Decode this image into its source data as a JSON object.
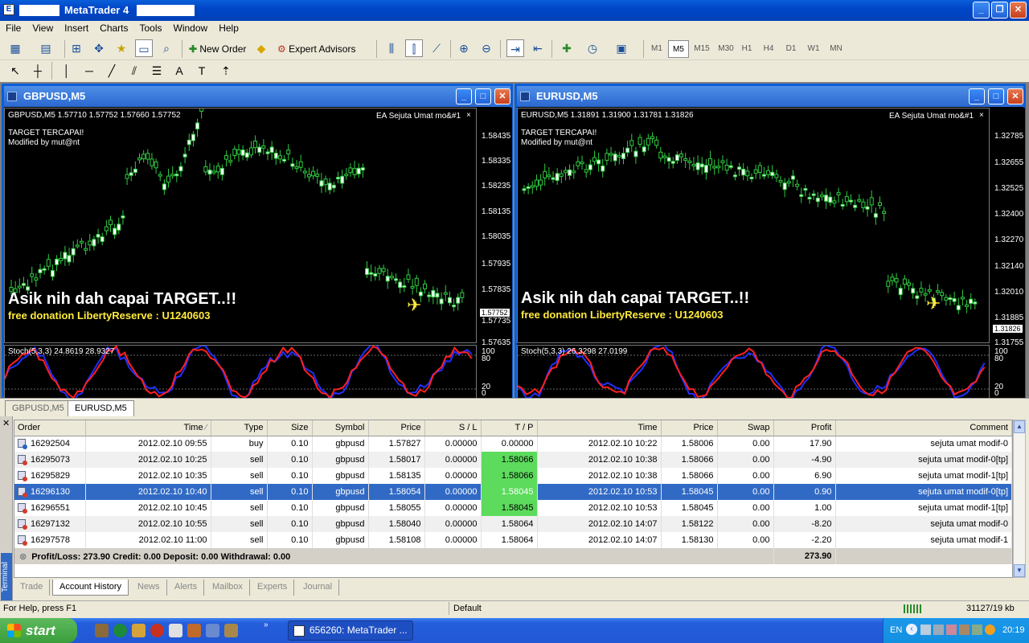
{
  "window": {
    "title": "MetaTrader 4"
  },
  "menu": [
    "File",
    "View",
    "Insert",
    "Charts",
    "Tools",
    "Window",
    "Help"
  ],
  "toolbar": {
    "new_order": "New Order",
    "expert_advisors": "Expert Advisors",
    "timeframes": [
      "M1",
      "M5",
      "M15",
      "M30",
      "H1",
      "H4",
      "D1",
      "W1",
      "MN"
    ],
    "active_timeframe": "M5"
  },
  "charts": {
    "gbp": {
      "title": "GBPUSD,M5",
      "info": "GBPUSD,M5  1.57710 1.57752 1.57660 1.57752",
      "ea": "EA Sejuta Umat mo&#1",
      "target": "TARGET TERCAPAI!",
      "modified": "Modified by mut@nt",
      "banner": "Asik nih dah capai TARGET..!!",
      "donation": "free donation LibertyReserve : U1240603",
      "stoch": "Stoch(5,3,3) 24.8619 28.9327",
      "price_current": "1.57752",
      "ticks": [
        "1.58435",
        "1.58335",
        "1.58235",
        "1.58135",
        "1.58035",
        "1.57935",
        "1.57835",
        "1.57735",
        "1.57635"
      ],
      "stoch_ticks": [
        "100",
        "80",
        "20",
        "0"
      ]
    },
    "eur": {
      "title": "EURUSD,M5",
      "info": "EURUSD,M5  1.31891 1.31900 1.31781 1.31826",
      "ea": "EA Sejuta Umat mo&#1",
      "target": "TARGET TERCAPAI!",
      "modified": "Modified by mut@nt",
      "banner": "Asik nih dah capai TARGET..!!",
      "donation": "free donation LibertyReserve : U1240603",
      "stoch": "Stoch(5,3,3) 26.3298 27.0199",
      "price_current": "1.31826",
      "ticks": [
        "1.32785",
        "1.32655",
        "1.32525",
        "1.32400",
        "1.32270",
        "1.32140",
        "1.32010",
        "1.31885",
        "1.31755"
      ],
      "stoch_ticks": [
        "100",
        "80",
        "20",
        "0"
      ]
    }
  },
  "window_tabs": [
    "GBPUSD,M5",
    "EURUSD,M5"
  ],
  "terminal": {
    "side_label": "Terminal",
    "columns": [
      "Order",
      "Time",
      "Type",
      "Size",
      "Symbol",
      "Price",
      "S / L",
      "T / P",
      "Time",
      "Price",
      "Swap",
      "Profit",
      "Comment"
    ],
    "rows": [
      {
        "order": "16292504",
        "open_time": "2012.02.10 09:55",
        "type": "buy",
        "size": "0.10",
        "symbol": "gbpusd",
        "price": "1.57827",
        "sl": "0.00000",
        "tp": "0.00000",
        "close_time": "2012.02.10 10:22",
        "close_price": "1.58006",
        "swap": "0.00",
        "profit": "17.90",
        "comment": "sejuta umat modif-0"
      },
      {
        "order": "16295073",
        "open_time": "2012.02.10 10:25",
        "type": "sell",
        "size": "0.10",
        "symbol": "gbpusd",
        "price": "1.58017",
        "sl": "0.00000",
        "tp": "1.58066",
        "close_time": "2012.02.10 10:38",
        "close_price": "1.58066",
        "swap": "0.00",
        "profit": "-4.90",
        "comment": "sejuta umat modif-0[tp]"
      },
      {
        "order": "16295829",
        "open_time": "2012.02.10 10:35",
        "type": "sell",
        "size": "0.10",
        "symbol": "gbpusd",
        "price": "1.58135",
        "sl": "0.00000",
        "tp": "1.58066",
        "close_time": "2012.02.10 10:38",
        "close_price": "1.58066",
        "swap": "0.00",
        "profit": "6.90",
        "comment": "sejuta umat modif-1[tp]"
      },
      {
        "order": "16296130",
        "open_time": "2012.02.10 10:40",
        "type": "sell",
        "size": "0.10",
        "symbol": "gbpusd",
        "price": "1.58054",
        "sl": "0.00000",
        "tp": "1.58045",
        "close_time": "2012.02.10 10:53",
        "close_price": "1.58045",
        "swap": "0.00",
        "profit": "0.90",
        "comment": "sejuta umat modif-0[tp]"
      },
      {
        "order": "16296551",
        "open_time": "2012.02.10 10:45",
        "type": "sell",
        "size": "0.10",
        "symbol": "gbpusd",
        "price": "1.58055",
        "sl": "0.00000",
        "tp": "1.58045",
        "close_time": "2012.02.10 10:53",
        "close_price": "1.58045",
        "swap": "0.00",
        "profit": "1.00",
        "comment": "sejuta umat modif-1[tp]"
      },
      {
        "order": "16297132",
        "open_time": "2012.02.10 10:55",
        "type": "sell",
        "size": "0.10",
        "symbol": "gbpusd",
        "price": "1.58040",
        "sl": "0.00000",
        "tp": "1.58064",
        "close_time": "2012.02.10 14:07",
        "close_price": "1.58122",
        "swap": "0.00",
        "profit": "-8.20",
        "comment": "sejuta umat modif-0"
      },
      {
        "order": "16297578",
        "open_time": "2012.02.10 11:00",
        "type": "sell",
        "size": "0.10",
        "symbol": "gbpusd",
        "price": "1.58108",
        "sl": "0.00000",
        "tp": "1.58064",
        "close_time": "2012.02.10 14:07",
        "close_price": "1.58130",
        "swap": "0.00",
        "profit": "-2.20",
        "comment": "sejuta umat modif-1"
      }
    ],
    "summary": "Profit/Loss: 273.90   Credit: 0.00   Deposit: 0.00   Withdrawal: 0.00",
    "total_profit": "273.90",
    "tabs": [
      "Trade",
      "Account History",
      "News",
      "Alerts",
      "Mailbox",
      "Experts",
      "Journal"
    ],
    "active_tab": "Account History"
  },
  "status": {
    "help": "For Help, press F1",
    "profile": "Default",
    "traffic": "31127/19 kb"
  },
  "taskbar": {
    "start": "start",
    "item": "656260: MetaTrader ...",
    "lang": "EN",
    "clock": "20:19"
  }
}
